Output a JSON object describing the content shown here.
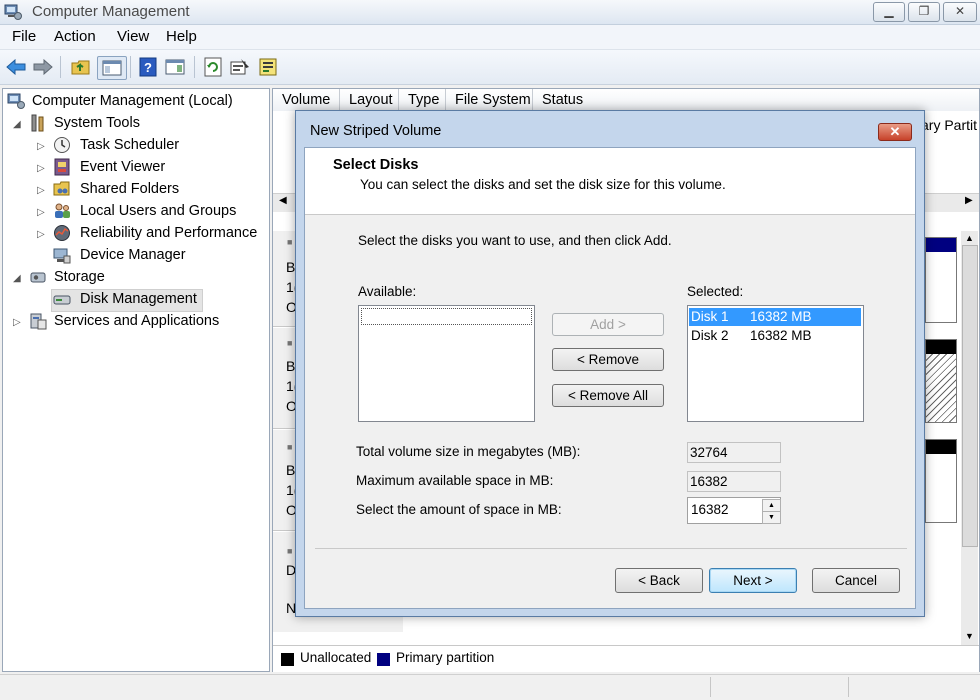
{
  "window": {
    "title": "Computer Management"
  },
  "menu": [
    "File",
    "Action",
    "View",
    "Help"
  ],
  "toolbar": {
    "icons": [
      "back-arrow-icon",
      "forward-arrow-icon",
      "up-folder-icon",
      "show-hide-tree-icon",
      "help-icon",
      "action-pane-icon",
      "refresh-icon",
      "properties-icon",
      "export-icon"
    ]
  },
  "tree": {
    "root": "Computer Management (Local)",
    "system_tools": "System Tools",
    "task_scheduler": "Task Scheduler",
    "event_viewer": "Event Viewer",
    "shared_folders": "Shared Folders",
    "local_users": "Local Users and Groups",
    "reliability": "Reliability and Performance",
    "device_manager": "Device Manager",
    "storage": "Storage",
    "disk_management": "Disk Management",
    "services": "Services and Applications"
  },
  "volume_list": {
    "columns": [
      "Volume",
      "Layout",
      "Type",
      "File System",
      "Status"
    ],
    "partial_right_text": "ary Partit"
  },
  "disk_rows": [
    {
      "l1": "B",
      "l2": "1(",
      "l3": "O"
    },
    {
      "l1": "B",
      "l2": "1(",
      "l3": "O"
    },
    {
      "l1": "B",
      "l2": "1(",
      "l3": "O"
    },
    {
      "l1": "D",
      "l2": "",
      "l3": "N"
    }
  ],
  "legend": {
    "unallocated": "Unallocated",
    "primary": "Primary partition"
  },
  "colors": {
    "unallocated": "#000000",
    "primary": "#000080",
    "selection": "#3399ff",
    "accent": "#1f4e96"
  },
  "dialog": {
    "title": "New Striped Volume",
    "close_label": "✕",
    "header_title": "Select Disks",
    "header_subtitle": "You can select the disks and set the disk size for this volume.",
    "instruction": "Select the disks you want to use, and then click Add.",
    "available_label": "Available:",
    "selected_label": "Selected:",
    "selected_disks": [
      {
        "name": "Disk 1",
        "size": "16382 MB"
      },
      {
        "name": "Disk 2",
        "size": "16382 MB"
      }
    ],
    "add_button": "Add >",
    "remove_button": "< Remove",
    "remove_all_button": "< Remove All",
    "total_label": "Total volume size in megabytes (MB):",
    "total_value": "32764",
    "max_label": "Maximum available space in MB:",
    "max_value": "16382",
    "amount_label": "Select the amount of space in MB:",
    "amount_value": "16382",
    "back_button": "< Back",
    "next_button": "Next >",
    "cancel_button": "Cancel"
  }
}
